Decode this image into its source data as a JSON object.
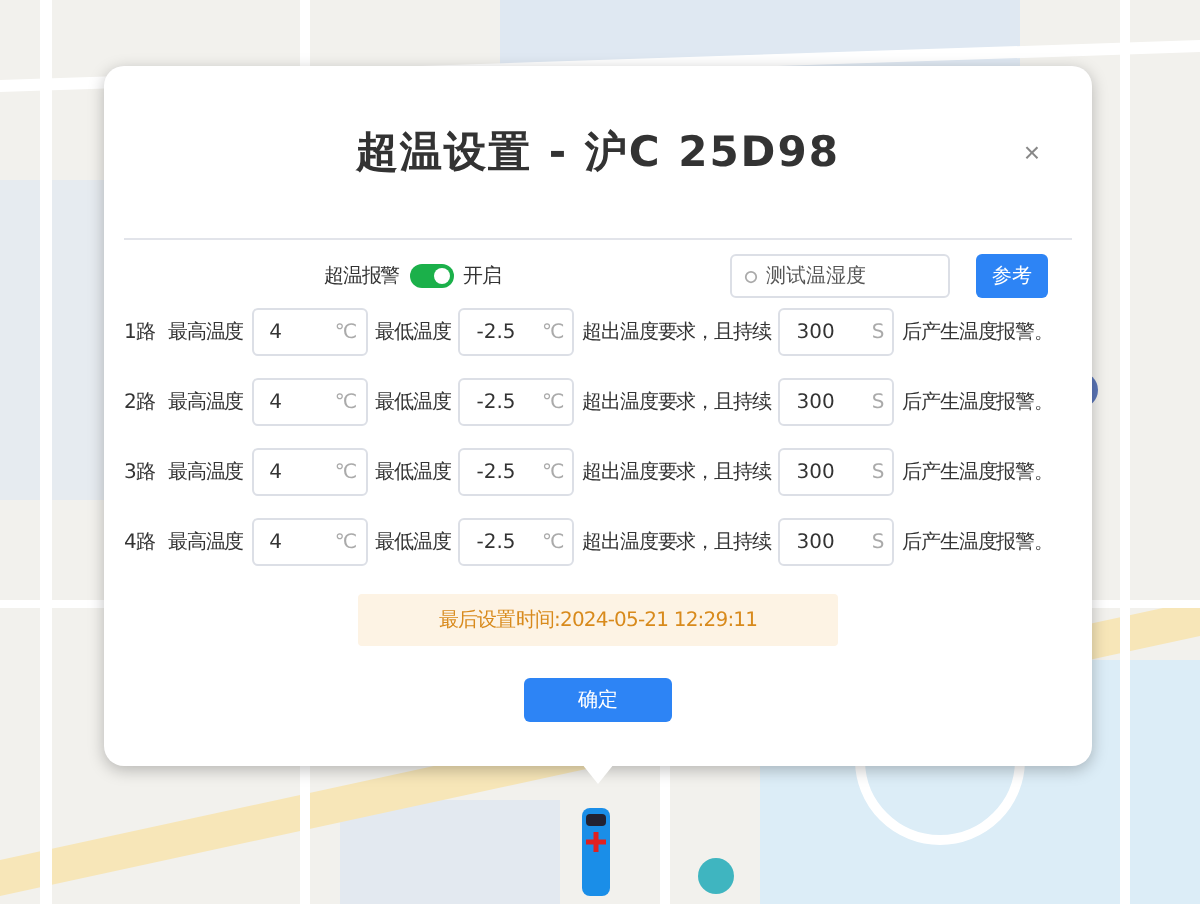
{
  "dialog": {
    "title": "超温设置 - 沪C 25D98",
    "close": "×",
    "alarm": {
      "label": "超温报警",
      "on": true,
      "state_label": "开启"
    },
    "test_field": {
      "placeholder": "测试温湿度"
    },
    "reference_button": "参考",
    "rows": [
      {
        "channel": "1路",
        "max_label": "最高温度",
        "max_value": "4",
        "max_unit": "℃",
        "min_label": "最低温度",
        "min_value": "-2.5",
        "min_unit": "℃",
        "duration_label": "超出温度要求，且持续",
        "duration_value": "300",
        "duration_unit": "S",
        "suffix": "后产生温度报警。"
      },
      {
        "channel": "2路",
        "max_label": "最高温度",
        "max_value": "4",
        "max_unit": "℃",
        "min_label": "最低温度",
        "min_value": "-2.5",
        "min_unit": "℃",
        "duration_label": "超出温度要求，且持续",
        "duration_value": "300",
        "duration_unit": "S",
        "suffix": "后产生温度报警。"
      },
      {
        "channel": "3路",
        "max_label": "最高温度",
        "max_value": "4",
        "max_unit": "℃",
        "min_label": "最低温度",
        "min_value": "-2.5",
        "min_unit": "℃",
        "duration_label": "超出温度要求，且持续",
        "duration_value": "300",
        "duration_unit": "S",
        "suffix": "后产生温度报警。"
      },
      {
        "channel": "4路",
        "max_label": "最高温度",
        "max_value": "4",
        "max_unit": "℃",
        "min_label": "最低温度",
        "min_value": "-2.5",
        "min_unit": "℃",
        "duration_label": "超出温度要求，且持续",
        "duration_value": "300",
        "duration_unit": "S",
        "suffix": "后产生温度报警。"
      }
    ],
    "notice": "最后设置时间:2024-05-21 12:29:11",
    "confirm_button": "确定"
  }
}
